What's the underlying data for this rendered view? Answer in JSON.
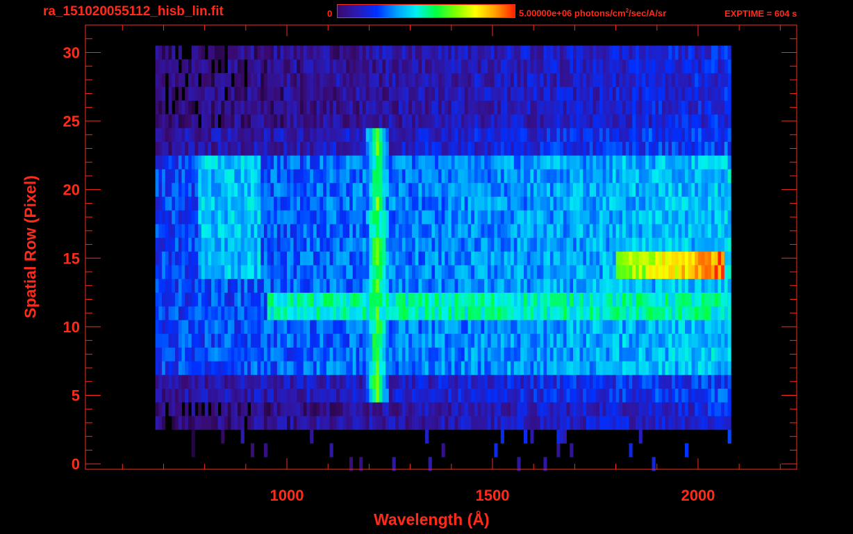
{
  "header": {
    "file_title": "ra_151020055112_hisb_lin.fit",
    "colorbar_min_label": "0",
    "colorbar_max_label_pre": "5.00000e+06 photons/cm",
    "colorbar_max_label_sup": "2",
    "colorbar_max_label_post": "/sec/A/sr",
    "exptime_label": "EXPTIME = 604 s"
  },
  "colors": {
    "axis": "#ff2a1a",
    "background": "#000000",
    "colormap": [
      "#000000",
      "#3a0a6e",
      "#2a1ab4",
      "#0030ff",
      "#00a0ff",
      "#00f0f0",
      "#00ff40",
      "#80ff00",
      "#ffff00",
      "#ffa000",
      "#ff2000"
    ]
  },
  "chart_data": {
    "type": "heatmap",
    "title": "ra_151020055112_hisb_lin.fit",
    "xlabel": "Wavelength (Å)",
    "ylabel": "Spatial Row (Pixel)",
    "xlim": [
      510,
      2240
    ],
    "ylim": [
      -0.4,
      32
    ],
    "x_ticks": [
      1000,
      1500,
      2000
    ],
    "y_ticks": [
      0,
      5,
      10,
      15,
      20,
      25,
      30
    ],
    "x_minor_step": 100,
    "y_minor_step": 1,
    "colorbar_range": [
      0,
      5000000
    ],
    "colorbar_units": "photons/cm^2/sec/A/sr",
    "exptime_s": 604,
    "grid": false,
    "data_extent": {
      "x": [
        680,
        2080
      ],
      "rows": [
        0,
        30
      ]
    },
    "features": [
      {
        "feature": "bright vertical emission line",
        "x": 1216,
        "rows": [
          5,
          24
        ],
        "intensity": 0.65
      },
      {
        "feature": "bright horizontal band",
        "x": [
          1800,
          2060
        ],
        "rows": [
          14,
          15
        ],
        "intensity": 0.95
      },
      {
        "feature": "horizontal band",
        "x": [
          950,
          2060
        ],
        "rows": [
          11,
          12
        ],
        "intensity": 0.6
      },
      {
        "feature": "curved arc",
        "x": [
          780,
          930
        ],
        "rows": [
          14,
          22
        ],
        "intensity": 0.5
      }
    ]
  }
}
